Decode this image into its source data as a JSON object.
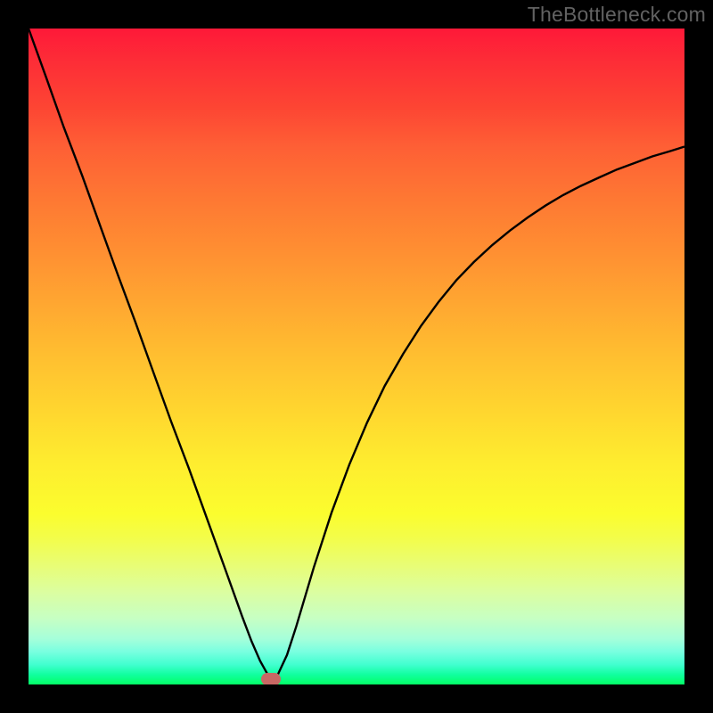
{
  "watermark": "TheBottleneck.com",
  "chart_data": {
    "type": "line",
    "title": "",
    "xlabel": "",
    "ylabel": "",
    "xlim": [
      0,
      1
    ],
    "ylim": [
      0,
      1
    ],
    "note": "Axes are tickless; values are normalized plot-area coordinates (0–1 on each axis, y=0 at bottom) read from pixel positions relative to the 736×736 plot region.",
    "series": [
      {
        "name": "curve",
        "x": [
          0.0,
          0.027,
          0.054,
          0.082,
          0.109,
          0.136,
          0.163,
          0.19,
          0.217,
          0.245,
          0.272,
          0.299,
          0.326,
          0.34,
          0.353,
          0.367,
          0.37,
          0.38,
          0.394,
          0.408,
          0.435,
          0.462,
          0.489,
          0.516,
          0.543,
          0.571,
          0.598,
          0.625,
          0.652,
          0.679,
          0.707,
          0.734,
          0.761,
          0.788,
          0.815,
          0.842,
          0.87,
          0.897,
          0.924,
          0.951,
          0.978,
          1.0
        ],
        "y": [
          1.0,
          0.925,
          0.849,
          0.775,
          0.7,
          0.625,
          0.552,
          0.477,
          0.402,
          0.328,
          0.253,
          0.178,
          0.103,
          0.066,
          0.036,
          0.011,
          0.008,
          0.015,
          0.045,
          0.088,
          0.179,
          0.262,
          0.335,
          0.399,
          0.455,
          0.504,
          0.546,
          0.583,
          0.616,
          0.644,
          0.67,
          0.692,
          0.712,
          0.73,
          0.746,
          0.76,
          0.773,
          0.785,
          0.795,
          0.805,
          0.813,
          0.82
        ]
      }
    ],
    "marker": {
      "x": 0.37,
      "y": 0.008,
      "color": "#c86864"
    },
    "background_gradient": {
      "direction": "vertical",
      "stops": [
        {
          "pos": 0.0,
          "color": "#fe1938"
        },
        {
          "pos": 0.5,
          "color": "#ffbf30"
        },
        {
          "pos": 0.74,
          "color": "#fbfd2e"
        },
        {
          "pos": 1.0,
          "color": "#03ff66"
        }
      ]
    }
  }
}
